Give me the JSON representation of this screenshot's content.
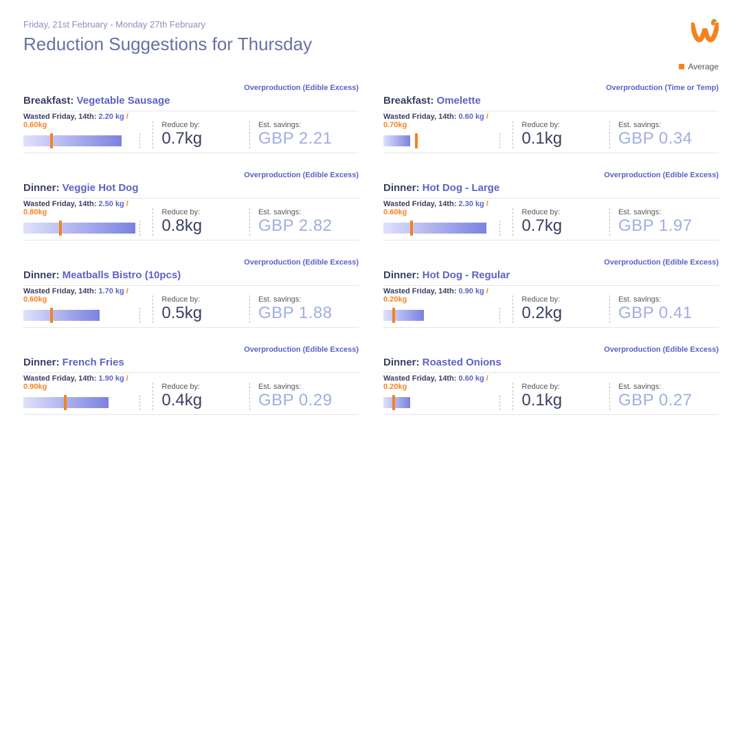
{
  "header": {
    "date_range": "Friday, 21st February - Monday 27th February",
    "title": "Reduction Suggestions for Thursday"
  },
  "legend": {
    "label": "Average"
  },
  "labels": {
    "wasted_prefix": "Wasted Friday, 14th:",
    "reduce_by": "Reduce by:",
    "est_savings": "Est. savings:",
    "sep": " / "
  },
  "max_bar_kg": 2.6,
  "cards": [
    {
      "meal": "Breakfast:",
      "dish": "Vegetable Sausage",
      "cause": "Overproduction (Edible Excess)",
      "wasted_kg": "2.20 kg",
      "avg_kg": "0.60kg",
      "bar": 2.2,
      "avg": 0.6,
      "reduce": "0.7kg",
      "savings": "GBP 2.21"
    },
    {
      "meal": "Breakfast:",
      "dish": "Omelette",
      "cause": "Overproduction (Time or Temp)",
      "wasted_kg": "0.60 kg",
      "avg_kg": "0.70kg",
      "bar": 0.6,
      "avg": 0.7,
      "reduce": "0.1kg",
      "savings": "GBP 0.34"
    },
    {
      "meal": "Dinner:",
      "dish": "Veggie Hot Dog",
      "cause": "Overproduction (Edible Excess)",
      "wasted_kg": "2.50 kg",
      "avg_kg": "0.80kg",
      "bar": 2.5,
      "avg": 0.8,
      "reduce": "0.8kg",
      "savings": "GBP 2.82"
    },
    {
      "meal": "Dinner:",
      "dish": "Hot Dog - Large",
      "cause": "Overproduction (Edible Excess)",
      "wasted_kg": "2.30 kg",
      "avg_kg": "0.60kg",
      "bar": 2.3,
      "avg": 0.6,
      "reduce": "0.7kg",
      "savings": "GBP 1.97"
    },
    {
      "meal": "Dinner:",
      "dish": "Meatballs Bistro (10pcs)",
      "cause": "Overproduction (Edible Excess)",
      "wasted_kg": "1.70 kg",
      "avg_kg": "0.60kg",
      "bar": 1.7,
      "avg": 0.6,
      "reduce": "0.5kg",
      "savings": "GBP 1.88"
    },
    {
      "meal": "Dinner:",
      "dish": "Hot Dog - Regular",
      "cause": "Overproduction (Edible Excess)",
      "wasted_kg": "0.90 kg",
      "avg_kg": "0.20kg",
      "bar": 0.9,
      "avg": 0.2,
      "reduce": "0.2kg",
      "savings": "GBP 0.41"
    },
    {
      "meal": "Dinner:",
      "dish": "French Fries",
      "cause": "Overproduction (Edible Excess)",
      "wasted_kg": "1.90 kg",
      "avg_kg": "0.90kg",
      "bar": 1.9,
      "avg": 0.9,
      "reduce": "0.4kg",
      "savings": "GBP 0.29"
    },
    {
      "meal": "Dinner:",
      "dish": "Roasted Onions",
      "cause": "Overproduction (Edible Excess)",
      "wasted_kg": "0.60 kg",
      "avg_kg": "0.20kg",
      "bar": 0.6,
      "avg": 0.2,
      "reduce": "0.1kg",
      "savings": "GBP 0.27"
    }
  ]
}
